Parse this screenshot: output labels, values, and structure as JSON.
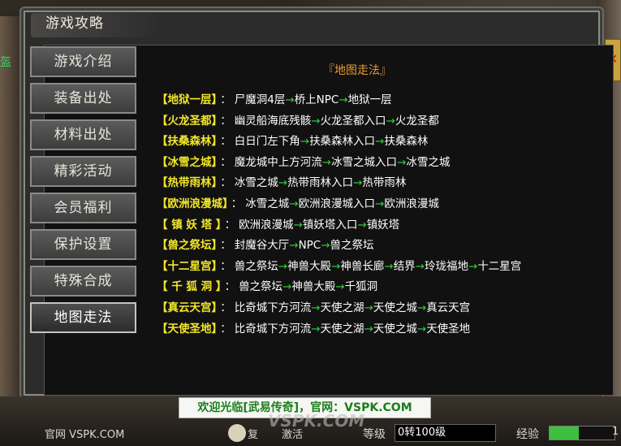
{
  "panel": {
    "title": "游戏攻略"
  },
  "sidebar": {
    "items": [
      {
        "label": "游戏介绍"
      },
      {
        "label": "装备出处"
      },
      {
        "label": "材料出处"
      },
      {
        "label": "精彩活动"
      },
      {
        "label": "会员福利"
      },
      {
        "label": "保护设置"
      },
      {
        "label": "特殊合成"
      },
      {
        "label": "地图走法"
      }
    ],
    "active_index": 7
  },
  "content": {
    "title": "『地图走法』",
    "rows": [
      {
        "name": "【地狱一层】",
        "sep": "：",
        "route": [
          "尸魔洞4层",
          "桥上NPC",
          "地狱一层"
        ]
      },
      {
        "name": "【火龙圣都】",
        "sep": "：",
        "route": [
          "幽灵船海底残骸",
          "火龙圣都入口",
          "火龙圣都"
        ]
      },
      {
        "name": "【扶桑森林】",
        "sep": "：",
        "route": [
          "白日门左下角",
          "扶桑森林入口",
          "扶桑森林"
        ]
      },
      {
        "name": "【冰雪之城】",
        "sep": "：",
        "route": [
          "魔龙城中上方河流",
          "冰雪之城入口",
          "冰雪之城"
        ]
      },
      {
        "name": "【热带雨林】",
        "sep": "：",
        "route": [
          "冰雪之城",
          "热带雨林入口",
          "热带雨林"
        ]
      },
      {
        "name": "【欧洲浪漫城】",
        "sep": "：",
        "route": [
          "冰雪之城",
          "欧洲浪漫城入口",
          "欧洲浪漫城"
        ]
      },
      {
        "name": "【 镇 妖 塔 】",
        "sep": "：",
        "route": [
          "欧洲浪漫城",
          "镇妖塔入口",
          "镇妖塔"
        ]
      },
      {
        "name": "【兽之祭坛】",
        "sep": "：",
        "route": [
          "封魔谷大厅",
          "NPC",
          "兽之祭坛"
        ]
      },
      {
        "name": "【十二星宫】",
        "sep": "：",
        "route": [
          "兽之祭坛",
          "神兽大殿",
          "神兽长廊",
          "结界",
          "玲珑福地",
          "十二星宫"
        ]
      },
      {
        "name": "【 千 狐 洞 】",
        "sep": "：",
        "route": [
          "兽之祭坛",
          "神兽大殿",
          "千狐洞"
        ]
      },
      {
        "name": "【真云天宫】",
        "sep": "：",
        "route": [
          "比奇城下方河流",
          "天使之湖",
          "天使之城",
          "真云天宫"
        ]
      },
      {
        "name": "【天使圣地】",
        "sep": "：",
        "route": [
          "比奇城下方河流",
          "天使之湖",
          "天使之城",
          "天使圣地"
        ]
      }
    ],
    "arrow": "→"
  },
  "hud": {
    "welcome": "欢迎光临[武易传奇]，官网：VSPK.COM",
    "site": "官网  VSPK.COM",
    "copy_label": "复",
    "activate_label": "激活",
    "logo_text": "VSPK.COM",
    "level_label": "等级",
    "level_value": "0转100级",
    "exp_label": "经验",
    "exp_fraction": 0.45,
    "exp_value": "1"
  },
  "background": {
    "left_label": "盔"
  },
  "colors": {
    "route_name": "#f2e62a",
    "arrow": "#35d635",
    "title": "#e89b32",
    "welcome_text": "#1a7e1a"
  }
}
